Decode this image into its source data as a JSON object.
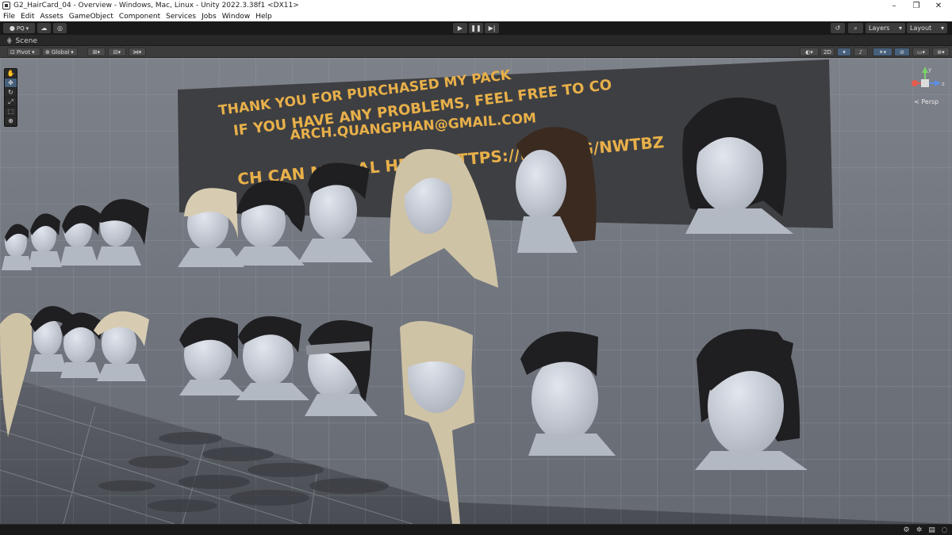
{
  "window": {
    "title": "G2_HairCard_04 - Overview - Windows, Mac, Linux - Unity 2022.3.38f1 <DX11>",
    "minimize": "–",
    "restore": "❐",
    "close": "✕"
  },
  "menu": [
    "File",
    "Edit",
    "Assets",
    "GameObject",
    "Component",
    "Services",
    "Jobs",
    "Window",
    "Help"
  ],
  "toolbar": {
    "account": "PQ",
    "play_icon": "play-icon",
    "pause_icon": "pause-icon",
    "step_icon": "step-icon",
    "layers": "Layers",
    "layout": "Layout"
  },
  "scene_tab": {
    "label": "Scene"
  },
  "scene_toolbar": {
    "pivot": "Pivot",
    "global": "Global",
    "mode_2d": "2D"
  },
  "viewport": {
    "banner_lines": [
      "THANK YOU FOR PURCHASED MY PACK",
      "IF YOU HAVE ANY PROBLEMS, FEEL FREE TO CO",
      "ARCH.QUANGPHAN@GMAIL.COM",
      "CH CAN       MOR       AL HERE: HTTPS://DISC      GG/NWTBZ"
    ],
    "gizmo_label": "< Persp",
    "gizmo_axes": {
      "y": "y",
      "z": "z"
    }
  },
  "colors": {
    "editor_bg": "#191919",
    "scene_bg": "#6c7078",
    "banner": "#444446",
    "banner_text": "#e8b04a",
    "head": "#c6ccd6",
    "hair_dark": "#1f1f22",
    "hair_brown": "#3a2a20",
    "hair_blonde": "#cfc3a6"
  }
}
